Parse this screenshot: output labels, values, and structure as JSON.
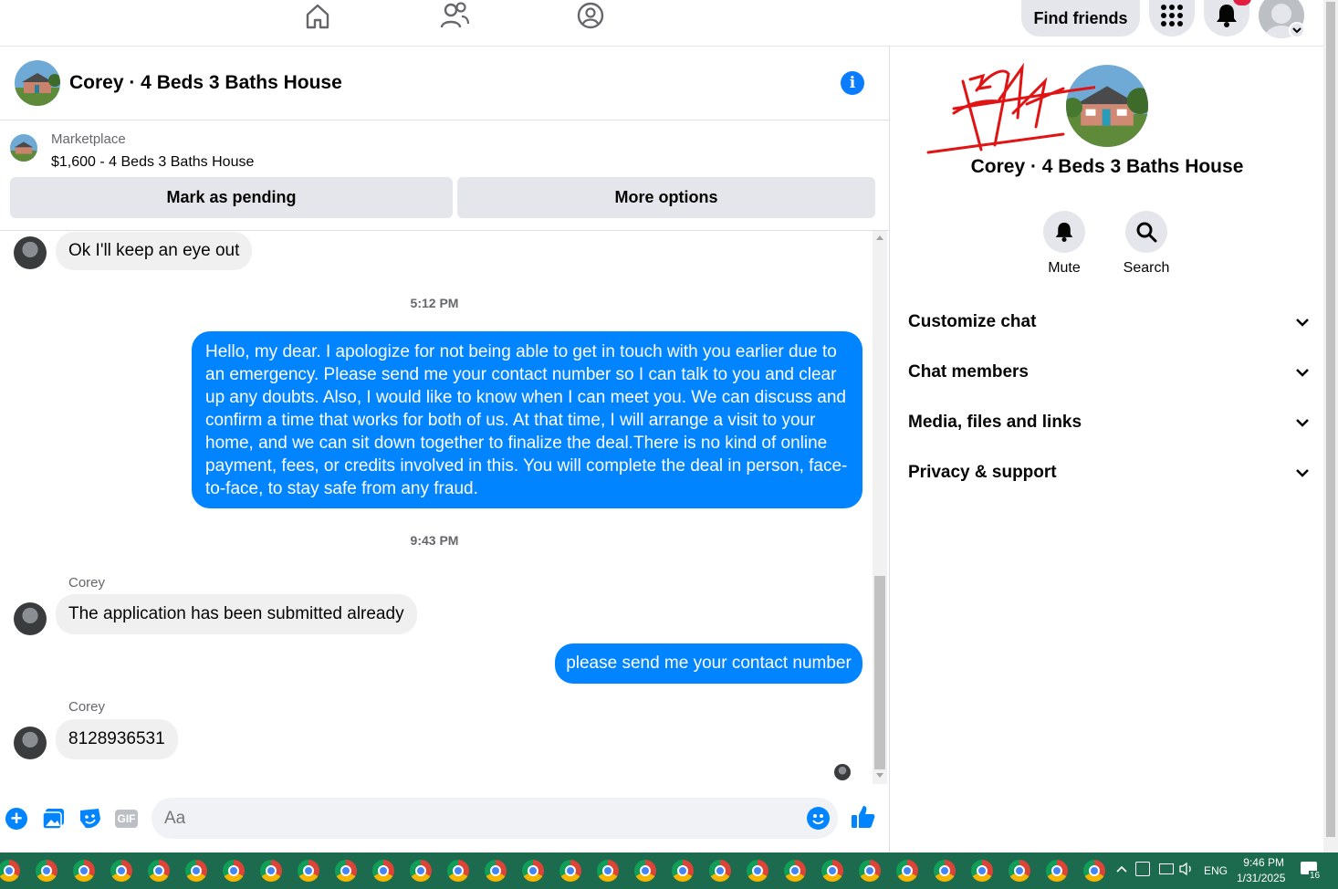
{
  "topnav": {
    "find_friends": "Find friends",
    "notifications_badge": ""
  },
  "chat": {
    "title": "Corey · 4 Beds 3 Baths House"
  },
  "marketplace": {
    "label": "Marketplace",
    "listing": "$1,600 - 4 Beds 3 Baths House",
    "mark_pending": "Mark as pending",
    "more_options": "More options"
  },
  "messages": {
    "m1": "Ok I'll keep an eye out",
    "ts1": "5:12 PM",
    "m2": "Hello, my dear. I apologize for not being able to get in touch with you earlier due to an emergency. Please send me your contact number so I can talk to you and clear up any doubts. Also, I would like to know when I can meet you. We can discuss and confirm a time that works for both of us. At that time, I will arrange a visit to your home, and we can sit down together to finalize the deal.There is no kind of online payment, fees, or credits involved in this. You will complete the deal in person, face-to-face, to stay safe from any fraud.",
    "ts2": "9:43 PM",
    "sender3": "Corey",
    "m3": "The application has been submitted already",
    "m4": "please send me your contact number",
    "sender5": "Corey",
    "m5": "8128936531"
  },
  "composer": {
    "placeholder": "Aa"
  },
  "right_panel": {
    "title": "Corey · 4 Beds 3 Baths House",
    "mute": "Mute",
    "search": "Search",
    "rows": [
      "Customize chat",
      "Chat members",
      "Media, files and links",
      "Privacy & support"
    ]
  },
  "taskbar": {
    "lang": "ENG",
    "time": "9:46 PM",
    "date": "1/31/2025",
    "notif_count": "16"
  },
  "colors": {
    "accent": "#0084ff",
    "info": "#0a7cff",
    "bubble_in": "#f0f0f0",
    "taskbar": "#1d6b4f"
  }
}
